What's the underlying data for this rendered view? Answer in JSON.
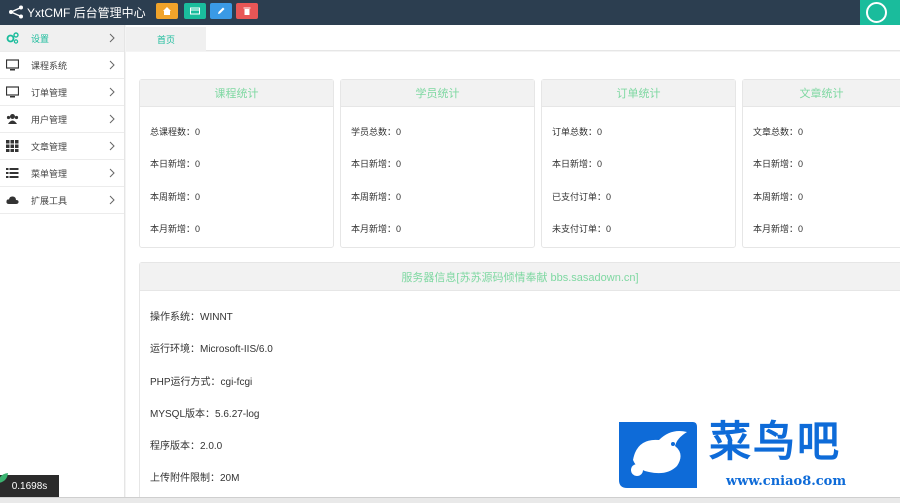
{
  "app": {
    "brand": "YxtCMF 后台管理中心",
    "quick_buttons": [
      {
        "icon": "home-icon",
        "color": "#f0a32a"
      },
      {
        "icon": "card-icon",
        "color": "#1abc9c"
      },
      {
        "icon": "pencil-icon",
        "color": "#3a9ae6"
      },
      {
        "icon": "trash-icon",
        "color": "#e85656"
      }
    ],
    "accent": "#1abc9c",
    "topbar_color": "#2c3e50"
  },
  "sidebar": {
    "items": [
      {
        "label": "设置",
        "icon": "gears-icon"
      },
      {
        "label": "课程系统",
        "icon": "monitor-icon"
      },
      {
        "label": "订单管理",
        "icon": "monitor-icon"
      },
      {
        "label": "用户管理",
        "icon": "users-icon"
      },
      {
        "label": "文章管理",
        "icon": "grid-icon"
      },
      {
        "label": "菜单管理",
        "icon": "list-icon"
      },
      {
        "label": "扩展工具",
        "icon": "cloud-icon"
      }
    ]
  },
  "tabs": {
    "home": "首页"
  },
  "stats": [
    {
      "title": "课程统计",
      "rows": [
        "总课程数：0",
        "本日新增：0",
        "本周新增：0",
        "本月新增：0"
      ]
    },
    {
      "title": "学员统计",
      "rows": [
        "学员总数：0",
        "本日新增：0",
        "本周新增：0",
        "本月新增：0"
      ]
    },
    {
      "title": "订单统计",
      "rows": [
        "订单总数：0",
        "本日新增：0",
        "已支付订单：0",
        "未支付订单：0"
      ]
    },
    {
      "title": "文章统计",
      "rows": [
        "文章总数：0",
        "本日新增：0",
        "本周新增：0",
        "本月新增：0"
      ]
    }
  ],
  "server": {
    "title": "服务器信息[苏苏源码倾情奉献 bbs.sasadown.cn]",
    "rows": [
      "操作系统：WINNT",
      "运行环境：Microsoft-IIS/6.0",
      "PHP运行方式：cgi-fcgi",
      "MYSQL版本：5.6.27-log",
      "程序版本：2.0.0",
      "上传附件限制：20M"
    ]
  },
  "debug": {
    "time": "0.1698s"
  },
  "watermark": {
    "cn": "菜鸟吧",
    "url": "www.cniao8.com"
  }
}
